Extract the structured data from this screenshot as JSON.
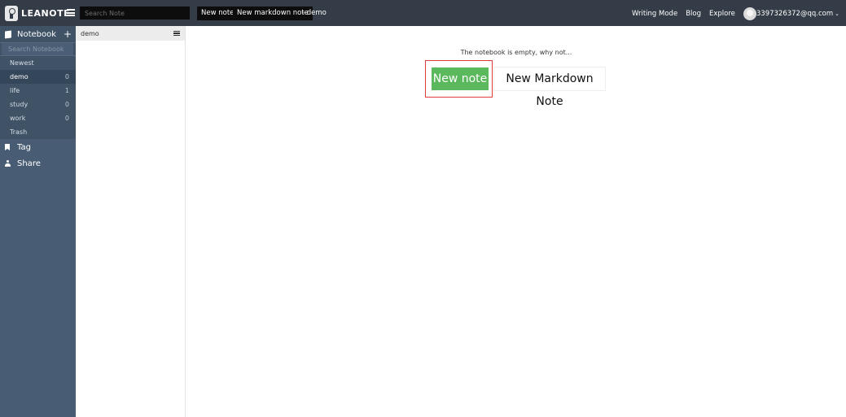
{
  "header": {
    "logo_text": "LEANOTE",
    "search_placeholder": "Search Note",
    "new_note_label": "New note",
    "new_markdown_label": "New markdown note",
    "current_notebook": "- demo",
    "links": {
      "writing_mode": "Writing Mode",
      "blog": "Blog",
      "explore": "Explore"
    },
    "user_email": "3397326372@qq.com"
  },
  "sidebar": {
    "notebook_label": "Notebook",
    "search_placeholder": "Search Notebook",
    "items": [
      {
        "label": "Newest",
        "count": ""
      },
      {
        "label": "demo",
        "count": "0"
      },
      {
        "label": "life",
        "count": "1"
      },
      {
        "label": "study",
        "count": "0"
      },
      {
        "label": "work",
        "count": "0"
      },
      {
        "label": "Trash",
        "count": ""
      }
    ],
    "tag_label": "Tag",
    "share_label": "Share"
  },
  "notelist": {
    "title": "demo"
  },
  "main": {
    "empty_message": "The notebook is empty, why not...",
    "new_note_button": "New note",
    "new_markdown_button": "New Markdown Note"
  },
  "colors": {
    "header_bg": "#333c47",
    "sidebar_bg": "#485d73",
    "accent_green": "#5cb85c",
    "highlight_red": "#e03c3c"
  }
}
